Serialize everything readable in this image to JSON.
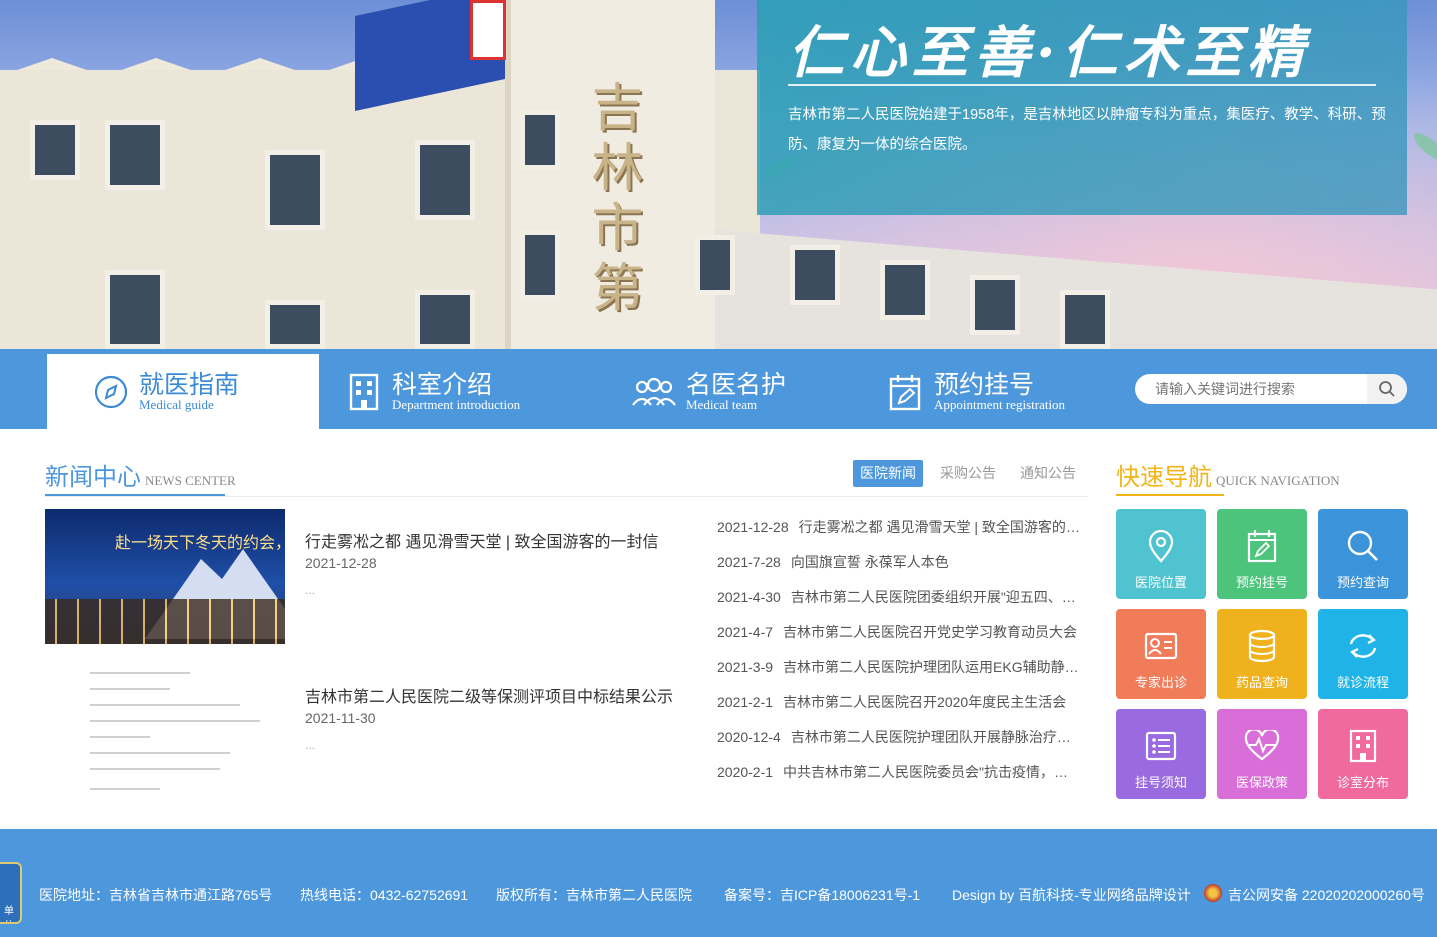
{
  "hero": {
    "slogan": "仁心至善·仁术至精",
    "description": "吉林市第二人民医院始建于1958年，是吉林地区以肿瘤专科为重点，集医疗、教学、科研、预防、康复为一体的综合医院。",
    "tower_text": "吉林市第"
  },
  "nav": {
    "items": [
      {
        "title": "就医指南",
        "sub": "Medical guide",
        "icon": "compass-icon"
      },
      {
        "title": "科室介绍",
        "sub": "Department introduction",
        "icon": "building-icon"
      },
      {
        "title": "名医名护",
        "sub": "Medical team",
        "icon": "people-icon"
      },
      {
        "title": "预约挂号",
        "sub": "Appointment registration",
        "icon": "calendar-edit-icon"
      }
    ],
    "search": {
      "placeholder": "请输入关键词进行搜索",
      "icon": "search-icon"
    }
  },
  "news": {
    "title": "新闻中心",
    "title_en": "NEWS CENTER",
    "tabs": [
      "医院新闻",
      "采购公告",
      "通知公告"
    ],
    "featured": [
      {
        "title": "行走雾凇之都 遇见滑雪天堂 | 致全国游客的一封信",
        "date": "2021-12-28",
        "excerpt": "...",
        "image_caption": "赴一场天下冬天的约会，以为造梦 畅享无限"
      },
      {
        "title": "吉林市第二人民医院二级等保测评项目中标结果公示",
        "date": "2021-11-30",
        "excerpt": "..."
      }
    ],
    "list": [
      {
        "date": "2021-12-28",
        "title": "行走雾凇之都 遇见滑雪天堂 | 致全国游客的一封信"
      },
      {
        "date": "2021-7-28",
        "title": "向国旗宣誓 永葆军人本色"
      },
      {
        "date": "2021-4-30",
        "title": "吉林市第二人民医院团委组织开展\"迎五四、学党史\"主题团日活动"
      },
      {
        "date": "2021-4-7",
        "title": "吉林市第二人民医院召开党史学习教育动员大会"
      },
      {
        "date": "2021-3-9",
        "title": "吉林市第二人民医院护理团队运用EKG辅助静脉治疗"
      },
      {
        "date": "2021-2-1",
        "title": "吉林市第二人民医院召开2020年度民主生活会"
      },
      {
        "date": "2020-12-4",
        "title": "吉林市第二人民医院护理团队开展静脉治疗专项培训"
      },
      {
        "date": "2020-2-1",
        "title": "中共吉林市第二人民医院委员会\"抗击疫情，党员先行\"倡议书"
      }
    ]
  },
  "quicknav": {
    "title": "快速导航",
    "title_en": "QUICK NAVIGATION",
    "items": [
      {
        "label": "医院位置",
        "icon": "location-pin-icon",
        "color": "#4fc3cf"
      },
      {
        "label": "预约挂号",
        "icon": "calendar-edit-icon",
        "color": "#4cc47c"
      },
      {
        "label": "预约查询",
        "icon": "search-icon",
        "color": "#3b94d9"
      },
      {
        "label": "专家出诊",
        "icon": "id-card-icon",
        "color": "#f07c5a"
      },
      {
        "label": "药品查询",
        "icon": "database-icon",
        "color": "#f0b21c"
      },
      {
        "label": "就诊流程",
        "icon": "refresh-icon",
        "color": "#1fb3e8"
      },
      {
        "label": "挂号须知",
        "icon": "list-icon",
        "color": "#9a6ae0"
      },
      {
        "label": "医保政策",
        "icon": "heart-pulse-icon",
        "color": "#d96ed8"
      },
      {
        "label": "诊室分布",
        "icon": "building-icon",
        "color": "#f06aa0"
      }
    ]
  },
  "footer": {
    "address": "医院地址：吉林省吉林市通江路765号",
    "hotline": "热线电话：0432-62752691",
    "copyright": "版权所有：吉林市第二人民医院",
    "icp": "备案号：吉ICP备18006231号-1",
    "design": "Design by 百航科技-专业网络品牌设计",
    "police": "吉公网安备 22020202000260号",
    "badge_text": "单位"
  }
}
